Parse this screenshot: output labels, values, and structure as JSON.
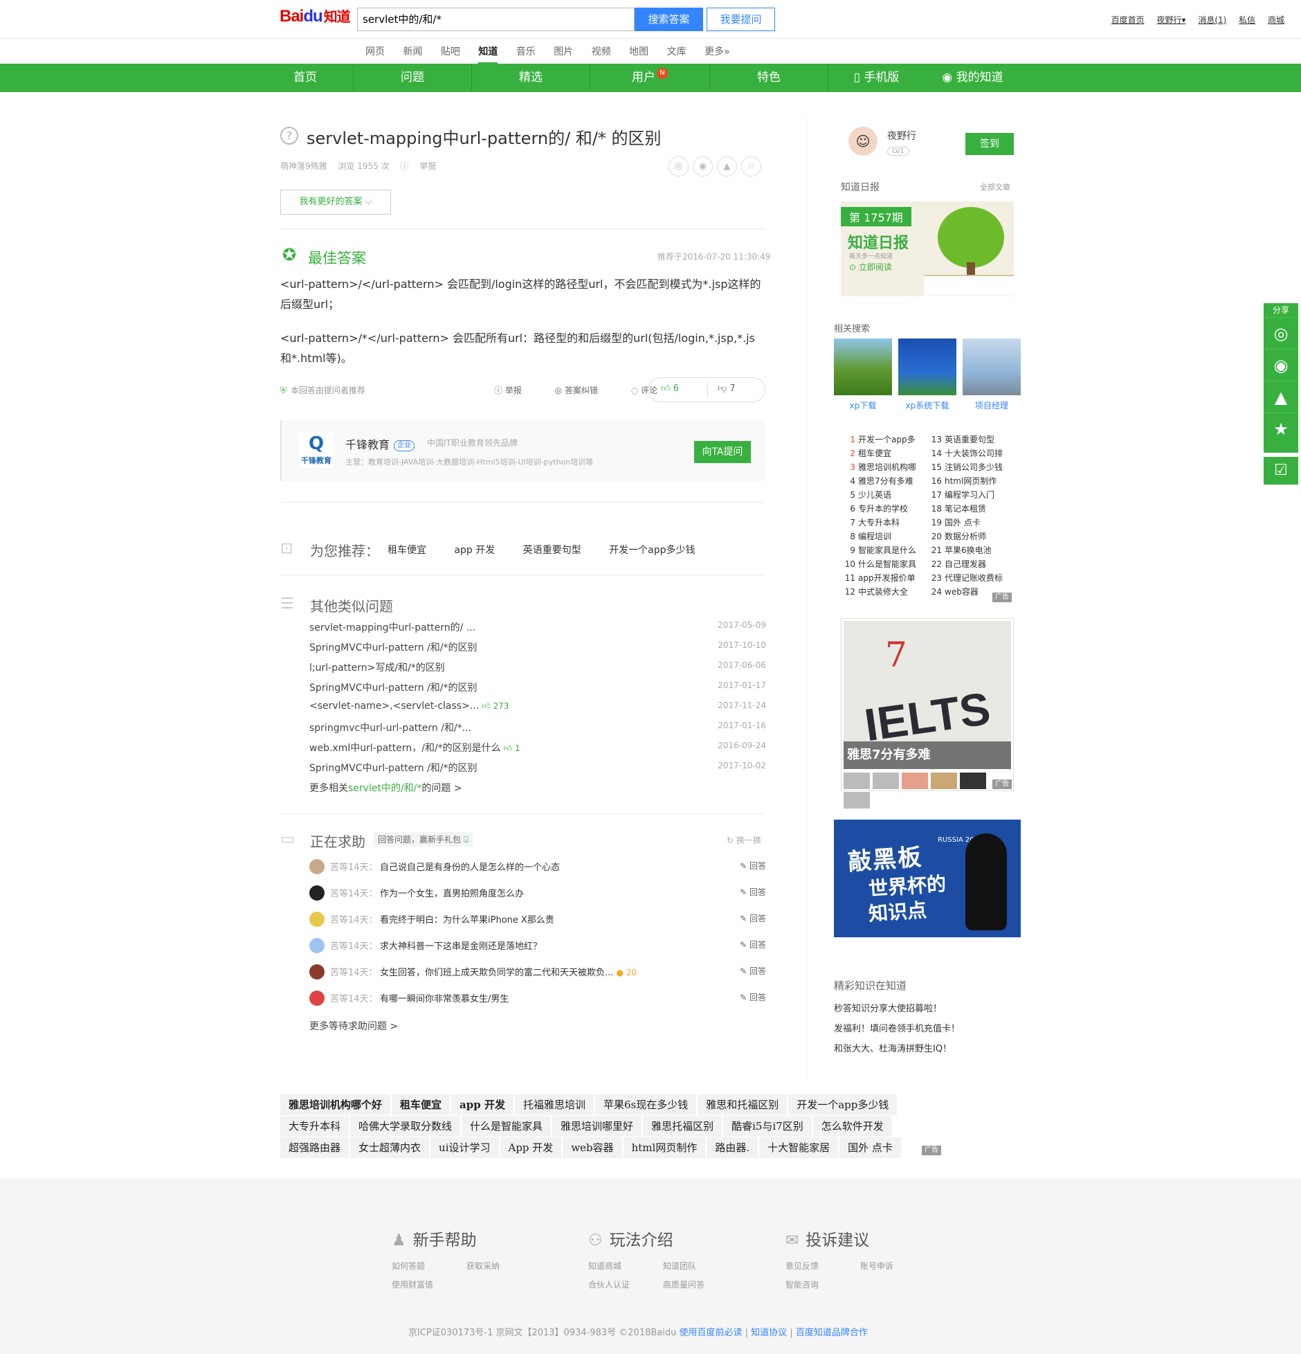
{
  "header": {
    "logo": {
      "bai": "Bai",
      "paw": "du",
      "zhidao": "知道"
    },
    "search_value": "servlet中的/和/*",
    "search_button": "搜索答案",
    "ask_button": "我要提问",
    "links": [
      "百度首页",
      "夜野行▾",
      "消息(1)",
      "私信",
      "商城"
    ]
  },
  "channels": [
    "网页",
    "新闻",
    "贴吧",
    "知道",
    "音乐",
    "图片",
    "视频",
    "地图",
    "文库",
    "更多»"
  ],
  "active_channel": "知道",
  "green_nav": {
    "items": [
      "首页",
      "问题",
      "精选",
      "用户",
      "特色"
    ],
    "badge": "N",
    "mobile": "手机版",
    "my": "我的知道"
  },
  "question": {
    "title": "servlet-mapping中url-pattern的/ 和/* 的区别",
    "asker": "萌神落9殇雅",
    "views": "浏览 1955 次",
    "report": "举报",
    "better_answer_button": "我有更好的答案 ⌵"
  },
  "best_answer": {
    "label": "最佳答案",
    "time": "推荐于2016-07-20 11:30:49",
    "paragraphs": [
      "<url-pattern>/</url-pattern> 会匹配到/login这样的路径型url，不会匹配到模式为*.jsp这样的后缀型url；",
      "<url-pattern>/*</url-pattern> 会匹配所有url：路径型的和后缀型的url(包括/login,*.jsp,*.js和*.html等)。"
    ],
    "recommend_note": "本回答由提问者推荐",
    "actions": [
      "举报",
      "答案纠错",
      "评论"
    ],
    "upvotes": "6",
    "downvotes": "7"
  },
  "brand": {
    "logo_text": "千锋教育",
    "name": "千锋教育",
    "badge": "企业",
    "slogan": "中国IT职业教育领先品牌",
    "main": "主营：教育培训-JAVA培训-大数据培训-Html5培训-UI培训-python培训等",
    "ask_button": "向TA提问"
  },
  "recommend": {
    "title": "为您推荐：",
    "tags": [
      "租车便宜",
      "app 开发",
      "英语重要句型",
      "开发一个app多少钱"
    ]
  },
  "similar": {
    "title": "其他类似问题",
    "items": [
      {
        "q": "servlet-mapping中url-pattern的/ ...",
        "like": "",
        "date": "2017-05-09"
      },
      {
        "q": "SpringMVC中url-pattern /和/*的区别",
        "like": "",
        "date": "2017-10-10"
      },
      {
        "q": "l;url-pattern>写成/和/*的区别",
        "like": "",
        "date": "2017-06-06"
      },
      {
        "q": "SpringMVC中url-pattern /和/*的区别",
        "like": "",
        "date": "2017-01-17"
      },
      {
        "q": "<servlet-name>,<servlet-class>...",
        "like": "273",
        "date": "2017-11-24"
      },
      {
        "q": "springmvc中url-url-pattern /和/*...",
        "like": "",
        "date": "2017-01-16"
      },
      {
        "q": "web.xml中url-pattern，/和/*的区别是什么",
        "like": "1",
        "date": "2016-09-24"
      },
      {
        "q": "SpringMVC中url-pattern /和/*的区别",
        "like": "",
        "date": "2017-10-02"
      }
    ],
    "more_prefix": "更多相关",
    "more_keyword": "servlet中的/和/*",
    "more_suffix": "的问题 >"
  },
  "help": {
    "title": "正在求助",
    "tag": "回答问题，赢新手礼包",
    "refresh": "换一换",
    "items": [
      {
        "pre": "苦等14天：",
        "q": "自己说自己是有身份的人是怎么样的一个心态",
        "coin": "",
        "ans": "回答"
      },
      {
        "pre": "苦等14天：",
        "q": "作为一个女生，直男拍照角度怎么办",
        "coin": "",
        "ans": "回答"
      },
      {
        "pre": "苦等14天：",
        "q": "看完终于明白：为什么苹果iPhone X那么贵",
        "coin": "",
        "ans": "回答"
      },
      {
        "pre": "苦等14天：",
        "q": "求大神科普一下这串是金刚还是落地红？",
        "coin": "",
        "ans": "回答"
      },
      {
        "pre": "苦等14天：",
        "q": "女生回答，你们班上成天欺负同学的富二代和天天被欺负...",
        "coin": "20",
        "ans": "回答"
      },
      {
        "pre": "苦等14天：",
        "q": "有哪一瞬间你非常羡慕女生/男生",
        "coin": "",
        "ans": "回答"
      }
    ],
    "more": "更多等待求助问题 >"
  },
  "sidebar": {
    "user": {
      "name": "夜野行",
      "level": "LV1",
      "sign_button": "签到"
    },
    "daily": {
      "title": "知道日报",
      "all": "全部文章",
      "issue": "第 1757期",
      "brand": "知道日报",
      "sub": "每天多一点知道",
      "read": "立即阅读"
    },
    "related": {
      "title": "相关搜索",
      "items": [
        {
          "caption": "xp下载",
          "color": "#5f9a32"
        },
        {
          "caption": "xp系统下载",
          "color": "#2a6fd1"
        },
        {
          "caption": "项目经理",
          "color": "#8fb5d8"
        }
      ]
    },
    "rank_left": [
      {
        "n": "1",
        "t": "开发一个app多"
      },
      {
        "n": "2",
        "t": "租车便宜"
      },
      {
        "n": "3",
        "t": "雅思培训机构哪"
      },
      {
        "n": "4",
        "t": "雅思7分有多难"
      },
      {
        "n": "5",
        "t": "少儿英语"
      },
      {
        "n": "6",
        "t": "专升本的学校"
      },
      {
        "n": "7",
        "t": "大专升本科"
      },
      {
        "n": "8",
        "t": "编程培训"
      },
      {
        "n": "9",
        "t": "智能家具是什么"
      },
      {
        "n": "10",
        "t": "什么是智能家具"
      },
      {
        "n": "11",
        "t": "app开发报价单"
      },
      {
        "n": "12",
        "t": "中式装修大全"
      }
    ],
    "rank_right": [
      {
        "n": "13",
        "t": "英语重要句型"
      },
      {
        "n": "14",
        "t": "十大装饰公司排"
      },
      {
        "n": "15",
        "t": "注销公司多少钱"
      },
      {
        "n": "16",
        "t": "html网页制作"
      },
      {
        "n": "17",
        "t": "编程学习入门"
      },
      {
        "n": "18",
        "t": "笔记本租赁"
      },
      {
        "n": "19",
        "t": "国外 点卡"
      },
      {
        "n": "20",
        "t": "数据分析师"
      },
      {
        "n": "21",
        "t": "苹果6换电池"
      },
      {
        "n": "22",
        "t": "自己理发器"
      },
      {
        "n": "23",
        "t": "代理记账收费标"
      },
      {
        "n": "24",
        "t": "web容器"
      }
    ],
    "ad_label": "广告",
    "ielts": {
      "red_text": "7",
      "big_text": "IELTS",
      "caption": "雅思7分有多难"
    },
    "worldcup": {
      "line1": "敲黑板",
      "line2": "世界杯的",
      "line3": "知识点",
      "year": "RUSSIA 2018"
    },
    "knowledge": {
      "title": "精彩知识在知道",
      "items": [
        "秒答知识分享大使招募啦！",
        "发福利！填问卷领手机充值卡！",
        "和张大大、杜海涛拼野生IQ！"
      ]
    }
  },
  "hot_words": [
    [
      {
        "t": "雅思培训机构哪个好",
        "b": true
      },
      {
        "t": "租车便宜",
        "b": true
      },
      {
        "t": "app 开发",
        "b": true
      },
      {
        "t": "托福雅思培训",
        "b": false
      },
      {
        "t": "苹果6s现在多少钱",
        "b": false
      },
      {
        "t": "雅思和托福区别",
        "b": false
      },
      {
        "t": "开发一个app多少钱",
        "b": false
      }
    ],
    [
      {
        "t": "大专升本科",
        "b": false
      },
      {
        "t": "哈佛大学录取分数线",
        "b": false
      },
      {
        "t": "什么是智能家具",
        "b": false
      },
      {
        "t": "雅思培训哪里好",
        "b": false
      },
      {
        "t": "雅思托福区别",
        "b": false
      },
      {
        "t": "酷睿i5与i7区别",
        "b": false
      },
      {
        "t": "怎么软件开发",
        "b": false
      }
    ],
    [
      {
        "t": "超强路由器",
        "b": false
      },
      {
        "t": "女士超薄内衣",
        "b": false
      },
      {
        "t": "ui设计学习",
        "b": false
      },
      {
        "t": "App 开发",
        "b": false
      },
      {
        "t": "web容器",
        "b": false
      },
      {
        "t": "html网页制作",
        "b": false
      },
      {
        "t": "路由器.",
        "b": false
      },
      {
        "t": "十大智能家居",
        "b": false
      },
      {
        "t": "国外 点卡",
        "b": false
      }
    ]
  ],
  "footer": {
    "cols": [
      {
        "title": "新手帮助",
        "links": [
          "如何答题",
          "获取采纳",
          "使用财富值"
        ]
      },
      {
        "title": "玩法介绍",
        "links": [
          "知道商城",
          "知道团队",
          "合伙人认证",
          "高质量问答"
        ]
      },
      {
        "title": "投诉建议",
        "links": [
          "意见反馈",
          "账号申诉",
          "智能咨询"
        ]
      }
    ],
    "copyright": "京ICP证030173号-1   京网文【2013】0934-983号     ©2018Baidu",
    "copyright_links": [
      "使用百度前必读",
      "知道协议",
      "百度知道品牌合作"
    ]
  },
  "side_share": {
    "label": "分享"
  },
  "colors": {
    "green": "#38b03f",
    "blue": "#3385ff",
    "red": "#e10602"
  }
}
